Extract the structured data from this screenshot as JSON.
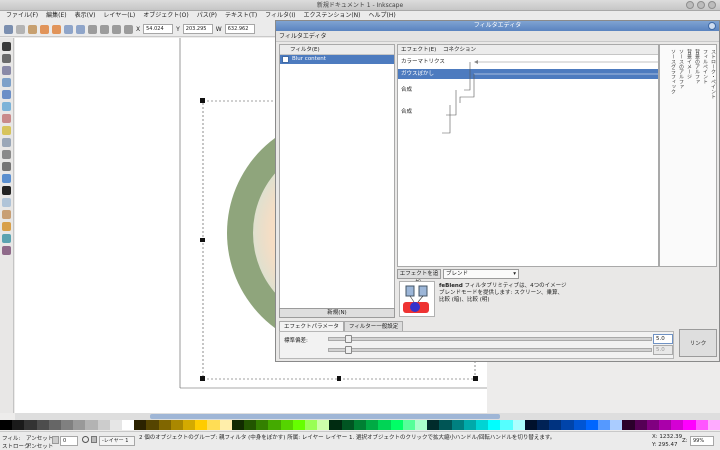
{
  "window": {
    "title": "新規ドキュメント 1 - Inkscape"
  },
  "menu": [
    "ファイル(F)",
    "編集(E)",
    "表示(V)",
    "レイヤー(L)",
    "オブジェクト(O)",
    "パス(P)",
    "テキスト(T)",
    "フィルタ(I)",
    "エクステンション(N)",
    "ヘルプ(H)"
  ],
  "toolctl": {
    "x_label": "X",
    "x_value": "54.024",
    "y_label": "Y",
    "y_value": "203.295",
    "w_label": "W",
    "w_value": "632.962"
  },
  "dialog": {
    "title": "フィルタエディタ",
    "header": "フィルタエディタ",
    "filter_col": "フィルタ(E)",
    "filter_name": "Blur content",
    "new_button": "新規(N)",
    "effect_col": "エフェクト(E)",
    "connection_col": "コネクション",
    "effects": [
      {
        "label": "カラーマトリクス",
        "selected": false
      },
      {
        "label": "ガウスぼかし",
        "selected": true
      },
      {
        "label": "合成",
        "selected": false
      },
      {
        "label": "合成",
        "selected": false
      }
    ],
    "connection_labels": [
      "ストローク・ペイント",
      "フィルペイント",
      "背景のアルファ",
      "背景イメージ",
      "ソースのアルファ",
      "ソースグラフィック"
    ],
    "add_effect_button": "エフェクトを追加:",
    "add_effect_select": "ブレンド",
    "desc_title": "feBlend",
    "desc_text": "フィルタプリミティブは、4つのイメージブレンドモードを提供します: スクリーン、乗算、比較 (暗)、比較 (明)",
    "tab_params": "エフェクトパラメータ",
    "tab_general": "フィルター一般設定",
    "param_label": "標準偏差:",
    "param_value": "5.0",
    "param_value2": "5.0",
    "link_button": "リンク"
  },
  "status": {
    "fill_label": "フィル:",
    "fill_value": "アンセット",
    "stroke_label": "ストローク:",
    "stroke_value": "アンセット",
    "opacity_value": "0",
    "layer_value": "-レイヤー 1",
    "message": "2 個のオブジェクトのグループ: 親フィルタ (中身をぼかす) 所属: レイヤー レイヤー 1. 選択オブジェクトのクリックで拡大縮小ハンドル/回転ハンドルを切り替えます。",
    "x_coord": "X: 1232.39",
    "y_coord": "Y: 295.47",
    "zoom_label": "Z:",
    "zoom_value": "99%"
  },
  "colors": {
    "accent": "#4d7bbf",
    "ring": "#8fa57c",
    "fill": "#fbe2c7"
  }
}
